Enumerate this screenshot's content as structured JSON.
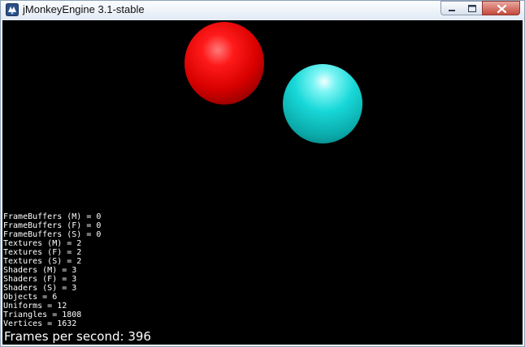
{
  "window": {
    "title": "jMonkeyEngine 3.1-stable",
    "icon": "jmonkeyengine-app-icon",
    "controls": [
      "minimize-icon",
      "maximize-icon",
      "close-icon"
    ]
  },
  "scene": {
    "background": "#000000",
    "objects": [
      {
        "name": "red-sphere",
        "color": "#ff0000"
      },
      {
        "name": "cyan-sphere",
        "color": "#00e0e0"
      }
    ]
  },
  "stats": [
    "FrameBuffers (M) = 0",
    "FrameBuffers (F) = 0",
    "FrameBuffers (S) = 0",
    "Textures (M) = 2",
    "Textures (F) = 2",
    "Textures (S) = 2",
    "Shaders (M) = 3",
    "Shaders (F) = 3",
    "Shaders (S) = 3",
    "Objects = 6",
    "Uniforms = 12",
    "Triangles = 1808",
    "Vertices = 1632"
  ],
  "fps": "Frames per second: 396"
}
